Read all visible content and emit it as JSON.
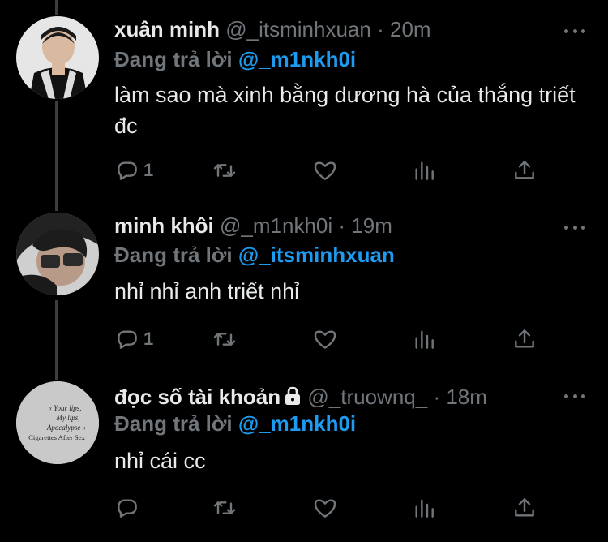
{
  "tweets": [
    {
      "name": "xuân minh",
      "handle": "@_itsminhxuan",
      "separator": "·",
      "time": "20m",
      "reply_prefix": "Đang trả lời",
      "reply_to": "@_m1nkh0i",
      "text": "làm sao mà xinh bằng dương hà của thắng triết đc",
      "reply_count": "1",
      "locked": false
    },
    {
      "name": "minh khôi",
      "handle": "@_m1nkh0i",
      "separator": "·",
      "time": "19m",
      "reply_prefix": "Đang trả lời",
      "reply_to": "@_itsminhxuan",
      "text": "nhỉ nhỉ anh triết nhỉ",
      "reply_count": "1",
      "locked": false
    },
    {
      "name": "đọc số tài khoản",
      "handle": "@_truownq_",
      "separator": "·",
      "time": "18m",
      "reply_prefix": "Đang trả lời",
      "reply_to": "@_m1nkh0i",
      "text": "nhỉ cái cc",
      "reply_count": "",
      "locked": true,
      "avatar_text": [
        "« Your lips,",
        "My lips,",
        "Apocalypse »",
        "Cigarettes After Sex"
      ]
    }
  ],
  "icons": [
    "reply-icon",
    "retweet-icon",
    "like-icon",
    "analytics-icon",
    "share-icon",
    "more-icon",
    "lock-icon"
  ],
  "colors": {
    "background": "#000000",
    "text": "#e7e9ea",
    "muted": "#71767b",
    "link": "#1d9bf0",
    "thread_line": "#3b3f43"
  }
}
